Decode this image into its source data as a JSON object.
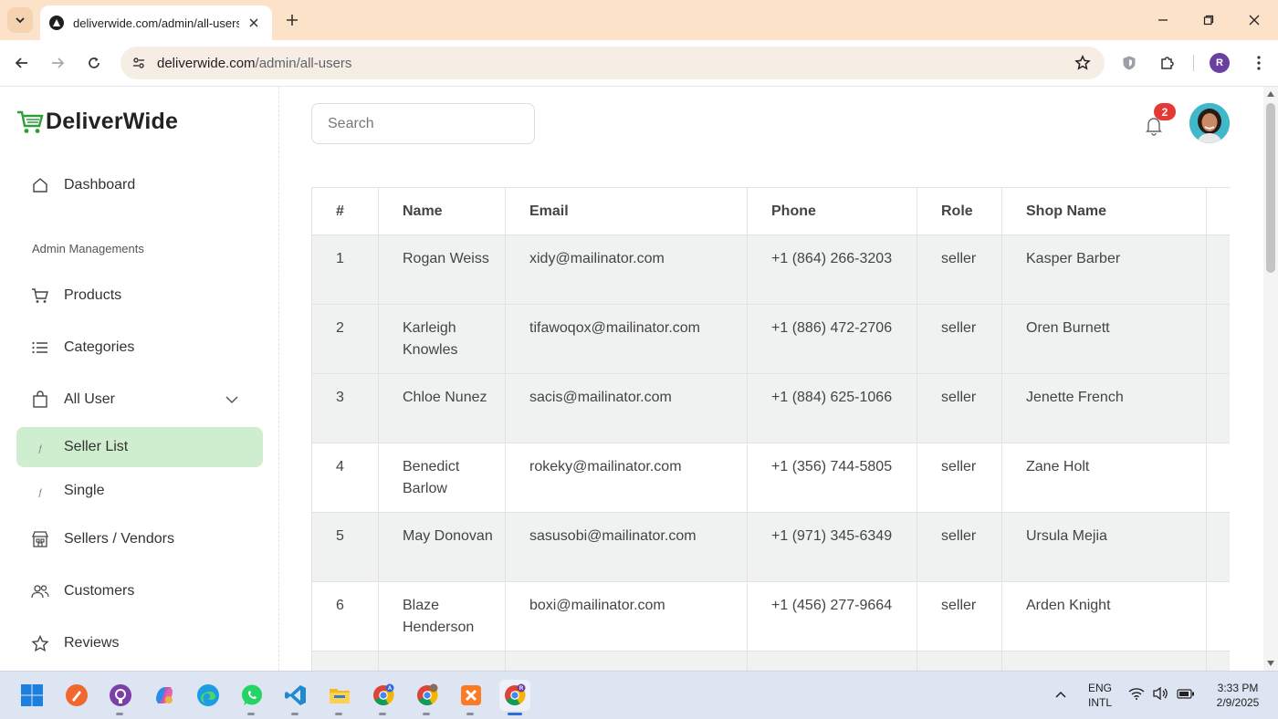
{
  "browser": {
    "tab_title": "deliverwide.com/admin/all-users",
    "url_host": "deliverwide.com",
    "url_path": "/admin/all-users",
    "profile_initial": "R"
  },
  "brand": {
    "name": "DeliverWide"
  },
  "sidebar": {
    "section_label": "Admin Managements",
    "items": [
      {
        "label": "Dashboard",
        "icon": "home-icon"
      },
      {
        "label": "Products",
        "icon": "cart-icon"
      },
      {
        "label": "Categories",
        "icon": "list-icon"
      },
      {
        "label": "All User",
        "icon": "bag-icon"
      },
      {
        "label": "Seller List",
        "icon": "slash-icon"
      },
      {
        "label": "Single",
        "icon": "slash-icon"
      },
      {
        "label": "Sellers / Vendors",
        "icon": "store-icon"
      },
      {
        "label": "Customers",
        "icon": "users-icon"
      },
      {
        "label": "Reviews",
        "icon": "star-icon"
      }
    ]
  },
  "header": {
    "search_placeholder": "Search",
    "notification_count": "2"
  },
  "table": {
    "columns": [
      "#",
      "Name",
      "Email",
      "Phone",
      "Role",
      "Shop Name"
    ],
    "rows": [
      {
        "n": "1",
        "name": "Rogan Weiss",
        "email": "xidy@mailinator.com",
        "phone": "+1 (864) 266-3203",
        "role": "seller",
        "shop": "Kasper Barber"
      },
      {
        "n": "2",
        "name": "Karleigh Knowles",
        "email": "tifawoqox@mailinator.com",
        "phone": "+1 (886) 472-2706",
        "role": "seller",
        "shop": "Oren Burnett"
      },
      {
        "n": "3",
        "name": "Chloe Nunez",
        "email": "sacis@mailinator.com",
        "phone": "+1 (884) 625-1066",
        "role": "seller",
        "shop": "Jenette French"
      },
      {
        "n": "4",
        "name": "Benedict Barlow",
        "email": "rokeky@mailinator.com",
        "phone": "+1 (356) 744-5805",
        "role": "seller",
        "shop": "Zane Holt"
      },
      {
        "n": "5",
        "name": "May Donovan",
        "email": "sasusobi@mailinator.com",
        "phone": "+1 (971) 345-6349",
        "role": "seller",
        "shop": "Ursula Mejia"
      },
      {
        "n": "6",
        "name": "Blaze Henderson",
        "email": "boxi@mailinator.com",
        "phone": "+1 (456) 277-9664",
        "role": "seller",
        "shop": "Arden Knight"
      }
    ]
  },
  "taskbar": {
    "language": "ENG",
    "layout": "INTL",
    "time": "3:33 PM",
    "date": "2/9/2025"
  },
  "colors": {
    "accent_green": "#2e9e3a",
    "active_item_bg": "#cfeecf",
    "badge_red": "#e53935",
    "tab_bar": "#fbe2c9"
  }
}
